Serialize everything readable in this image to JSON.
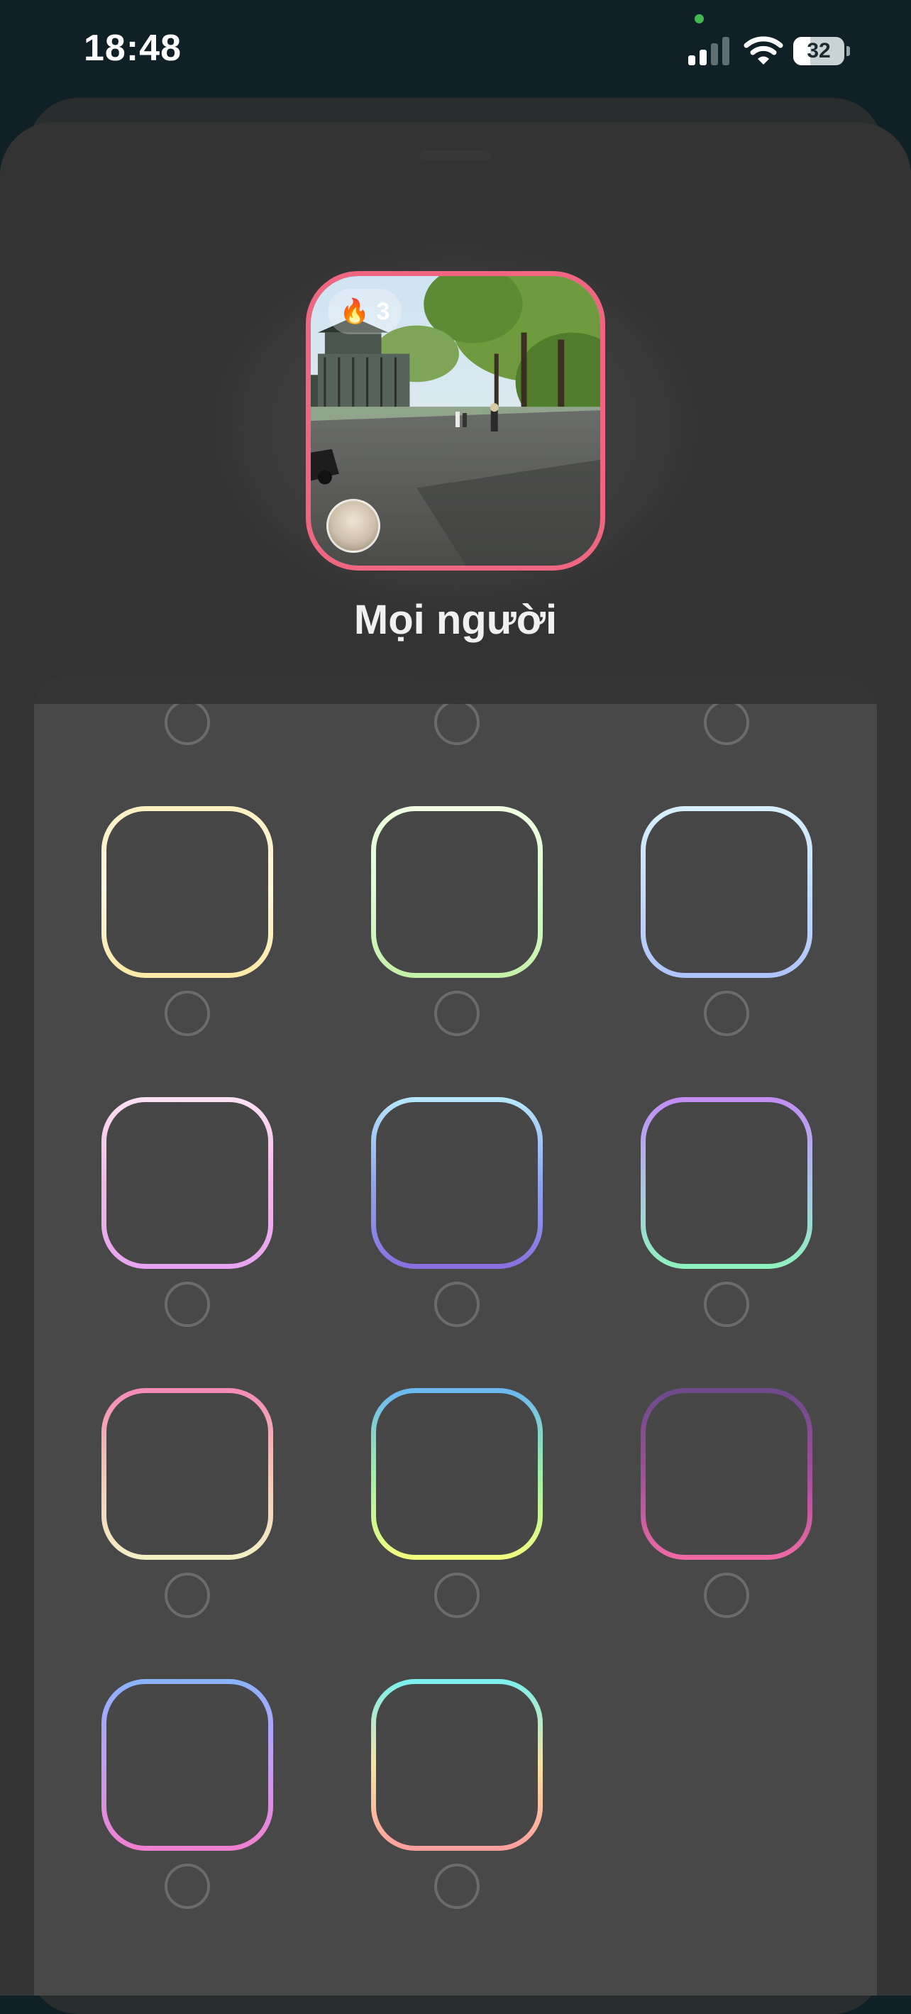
{
  "status": {
    "time": "18:48",
    "battery": "32",
    "icons": [
      "cellular-signal-icon",
      "wifi-icon",
      "battery-icon"
    ]
  },
  "preview": {
    "streak": "3",
    "streak_icon": "flame-icon",
    "border_color": "#f06680",
    "title": "Mọi người"
  },
  "frames": [
    {
      "id": "frame-cream",
      "colors": [
        "#fff3c4",
        "#fff7d9",
        "#ffe9a6"
      ]
    },
    {
      "id": "frame-mint",
      "colors": [
        "#f2ffe2",
        "#d8ffd0",
        "#c4f1a8"
      ]
    },
    {
      "id": "frame-ice-blue",
      "colors": [
        "#d8f1ff",
        "#c1dcff",
        "#aec4ff"
      ]
    },
    {
      "id": "frame-pastel-pink",
      "colors": [
        "#ffe1f4",
        "#f4b6ea",
        "#e6a4f0"
      ]
    },
    {
      "id": "frame-periwinkle",
      "colors": [
        "#b6e7ff",
        "#8da7f0",
        "#8a6fe0"
      ]
    },
    {
      "id": "frame-violet-green",
      "colors": [
        "#c48cf5",
        "#a9c3e6",
        "#8ff2be"
      ]
    },
    {
      "id": "frame-pink-yellow",
      "colors": [
        "#f48ab8",
        "#f6c7b4",
        "#f3f0c4"
      ]
    },
    {
      "id": "frame-blue-lime",
      "colors": [
        "#6ab7f3",
        "#9ff0a6",
        "#f4ff7d"
      ]
    },
    {
      "id": "frame-plum-pink",
      "colors": [
        "#6d4a8a",
        "#a04f9c",
        "#f06aa6"
      ]
    },
    {
      "id": "frame-blue-orchid",
      "colors": [
        "#8ab3ff",
        "#c69cf4",
        "#f27fd0"
      ]
    },
    {
      "id": "frame-aqua-peach",
      "colors": [
        "#7af0ef",
        "#f9e2a0",
        "#ff9e9b"
      ]
    }
  ]
}
